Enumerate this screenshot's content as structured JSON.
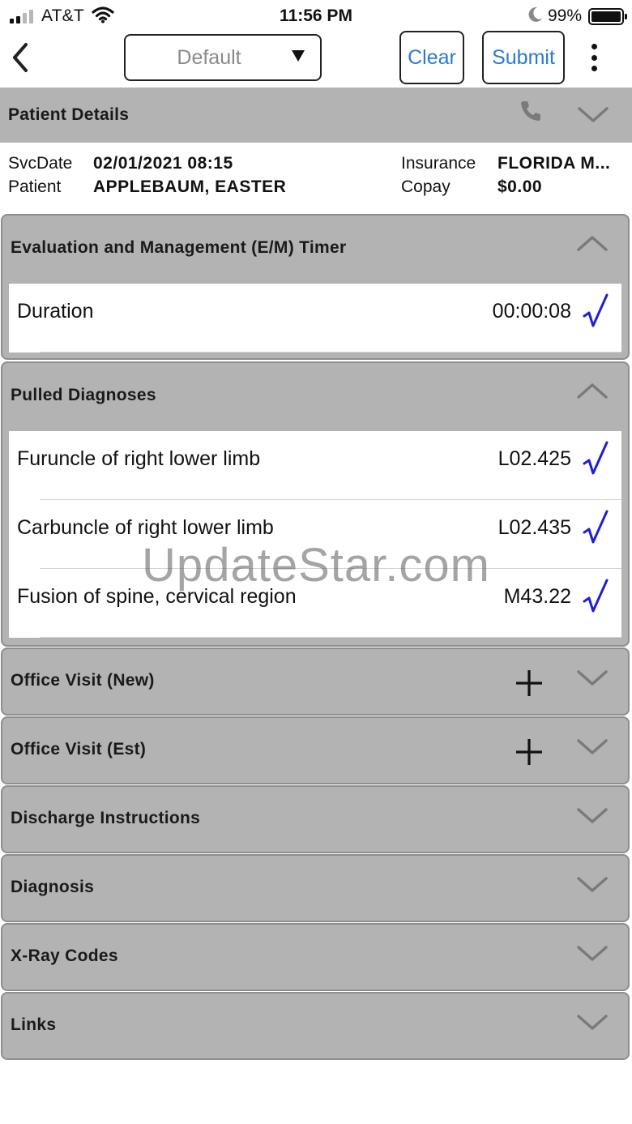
{
  "status_bar": {
    "carrier": "AT&T",
    "time": "11:56 PM",
    "battery_percent": "99%",
    "signal_bars": 2,
    "icons": [
      "signal-icon",
      "wifi-icon",
      "moon-icon",
      "battery-icon"
    ]
  },
  "toolbar": {
    "back_icon": "chevron-left-icon",
    "template_select": {
      "value": "Default",
      "arrow": "▼"
    },
    "clear_label": "Clear",
    "submit_label": "Submit",
    "more_icon": "vertical-dots-icon",
    "accent_color": "#2a7ad8"
  },
  "patient_details": {
    "title": "Patient Details",
    "icons": [
      "phone-icon",
      "chevron-down-icon"
    ],
    "svc_date_label": "SvcDate",
    "svc_date": "02/01/2021 08:15",
    "patient_label": "Patient",
    "patient": "APPLEBAUM, EASTER",
    "insurance_label": "Insurance",
    "insurance": "FLORIDA M...",
    "copay_label": "Copay",
    "copay": "$0.00"
  },
  "em_timer": {
    "title": "Evaluation and Management (E/M) Timer",
    "expanded": true,
    "rows": [
      {
        "label": "Duration",
        "value": "00:00:08",
        "checked": true
      }
    ]
  },
  "pulled_diagnoses": {
    "title": "Pulled Diagnoses",
    "expanded": true,
    "rows": [
      {
        "label": "Furuncle of right lower limb",
        "value": "L02.425",
        "checked": true
      },
      {
        "label": "Carbuncle of right lower limb",
        "value": "L02.435",
        "checked": true
      },
      {
        "label": "Fusion of spine, cervical region",
        "value": "M43.22",
        "checked": true
      }
    ]
  },
  "collapsed_sections": [
    {
      "title": "Office Visit (New)",
      "has_add": true
    },
    {
      "title": "Office Visit (Est)",
      "has_add": true
    },
    {
      "title": "Discharge Instructions",
      "has_add": false
    },
    {
      "title": "Diagnosis",
      "has_add": false
    },
    {
      "title": "X-Ray Codes",
      "has_add": false
    },
    {
      "title": "Links",
      "has_add": false
    }
  ],
  "check_color": "#1e1ed2",
  "watermark": "UpdateStar.com"
}
